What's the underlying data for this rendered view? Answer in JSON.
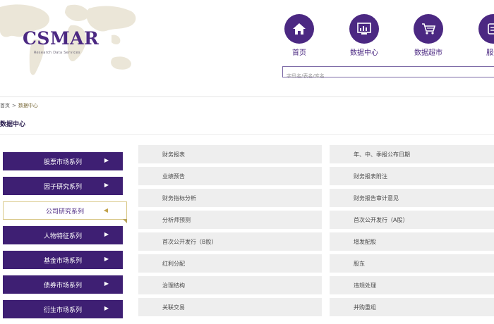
{
  "brand": {
    "name": "CSMAR",
    "tagline": "Research Data Services"
  },
  "nav": [
    {
      "label": "首页",
      "icon": "home-icon"
    },
    {
      "label": "数据中心",
      "icon": "data-chart-icon"
    },
    {
      "label": "数据超市",
      "icon": "shopping-cart-icon"
    },
    {
      "label": "服务",
      "icon": "service-icon"
    }
  ],
  "search": {
    "placeholder": "字段名/表名/库名"
  },
  "breadcrumb": {
    "home": "首页",
    "separator": ">",
    "current": "数据中心"
  },
  "page_title": "数据中心",
  "sidebar": {
    "items": [
      {
        "label": "股票市场系列",
        "active": false
      },
      {
        "label": "因子研究系列",
        "active": false
      },
      {
        "label": "公司研究系列",
        "active": true
      },
      {
        "label": "人物特征系列",
        "active": false
      },
      {
        "label": "基金市场系列",
        "active": false
      },
      {
        "label": "债券市场系列",
        "active": false
      },
      {
        "label": "衍生市场系列",
        "active": false
      }
    ]
  },
  "grid": {
    "rows": [
      [
        "财务报表",
        "年、中、季报公布日期"
      ],
      [
        "业绩预告",
        "财务报表附注"
      ],
      [
        "财务指标分析",
        "财务报告审计意见"
      ],
      [
        "分析师预测",
        "首次公开发行（A股）"
      ],
      [
        "首次公开发行（B股）",
        "增发配股"
      ],
      [
        "红利分配",
        "股东"
      ],
      [
        "治理结构",
        "违规处理"
      ],
      [
        "关联交易",
        "并购重组"
      ]
    ]
  },
  "colors": {
    "brand": "#4b2882",
    "sidebar": "#3e1f73",
    "cell_bg": "#eeeeee",
    "gold": "#c2a34b"
  }
}
